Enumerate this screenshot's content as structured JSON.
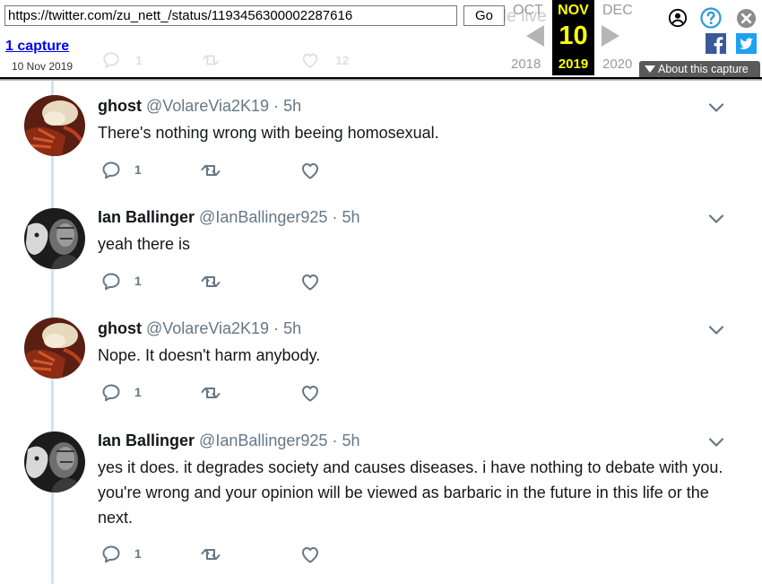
{
  "wayback": {
    "url": "https://twitter.com/zu_nett_/status/1193456300002287616",
    "go_label": "Go",
    "captures_label": "1 capture",
    "capture_date": "10 Nov 2019",
    "prev_month": "OCT",
    "current_month": "NOV",
    "next_month": "DEC",
    "prev_year": "2018",
    "current_day": "10",
    "current_year": "2019",
    "next_year": "2020",
    "about_label": "About this capture",
    "accent_color": "#ffff00",
    "icons": [
      "user-icon",
      "help-icon",
      "close-icon",
      "facebook-icon",
      "twitter-icon"
    ]
  },
  "background_tweet": {
    "text_fragment": "ople live in",
    "reply_count": "1",
    "like_count": "12"
  },
  "tweets": [
    {
      "name": "ghost",
      "handle": "@VolareVia2K19",
      "separator": "·",
      "time": "5h",
      "text": "There's nothing wrong with beeing homosexual.",
      "reply_count": "1"
    },
    {
      "name": "Ian Ballinger",
      "handle": "@IanBallinger925",
      "separator": "·",
      "time": "5h",
      "text": "yeah there is",
      "reply_count": "1"
    },
    {
      "name": "ghost",
      "handle": "@VolareVia2K19",
      "separator": "·",
      "time": "5h",
      "text": "Nope. It doesn't harm anybody.",
      "reply_count": "1"
    },
    {
      "name": "Ian Ballinger",
      "handle": "@IanBallinger925",
      "separator": "·",
      "time": "5h",
      "text": "yes it does. it degrades society and causes diseases. i have nothing to debate with you. you're wrong and your opinion will be viewed as barbaric in the future in this life or the next.",
      "reply_count": "1"
    }
  ],
  "colors": {
    "thread_line": "#cbe5f6",
    "secondary_text": "#657786",
    "primary_text": "#14171a",
    "link": "#0000ee"
  }
}
